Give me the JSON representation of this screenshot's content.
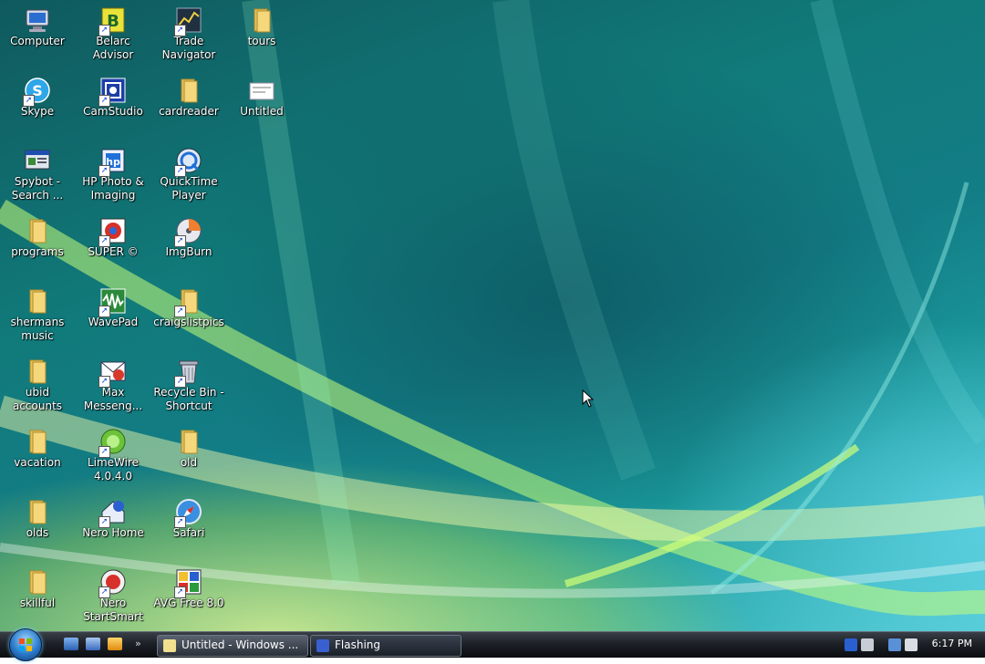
{
  "desktop_icons": [
    {
      "label": "Computer"
    },
    {
      "label": "Belarc Advisor"
    },
    {
      "label": "Trade Navigator"
    },
    {
      "label": "tours"
    },
    {
      "label": "Skype"
    },
    {
      "label": "CamStudio"
    },
    {
      "label": "cardreader"
    },
    {
      "label": "Untitled"
    },
    {
      "label": "Spybot - Search ..."
    },
    {
      "label": "HP Photo & Imaging"
    },
    {
      "label": "QuickTime Player"
    },
    {
      "label": "programs"
    },
    {
      "label": "SUPER ©"
    },
    {
      "label": "ImgBurn"
    },
    {
      "label": "shermans music"
    },
    {
      "label": "WavePad"
    },
    {
      "label": "craigslistpics"
    },
    {
      "label": "ubid accounts"
    },
    {
      "label": "Max Messeng..."
    },
    {
      "label": "Recycle Bin - Shortcut"
    },
    {
      "label": "vacation"
    },
    {
      "label": "LimeWire 4.0.4.0"
    },
    {
      "label": "old"
    },
    {
      "label": "olds"
    },
    {
      "label": "Nero Home"
    },
    {
      "label": "Safari"
    },
    {
      "label": "skillful"
    },
    {
      "label": "Nero StartSmart"
    },
    {
      "label": "AVG Free 8.0"
    }
  ],
  "taskbar": {
    "quick_launch": [
      "show-desktop-icon",
      "switch-windows-icon",
      "media-player-icon"
    ],
    "tasks": [
      {
        "label": "Untitled - Windows ..."
      },
      {
        "label": "Flashing"
      }
    ],
    "clock": "6:17 PM"
  },
  "colors": {
    "taskbar": "#1d2127",
    "start_orb": "#2a79c9",
    "desktop": "#117a7a"
  }
}
